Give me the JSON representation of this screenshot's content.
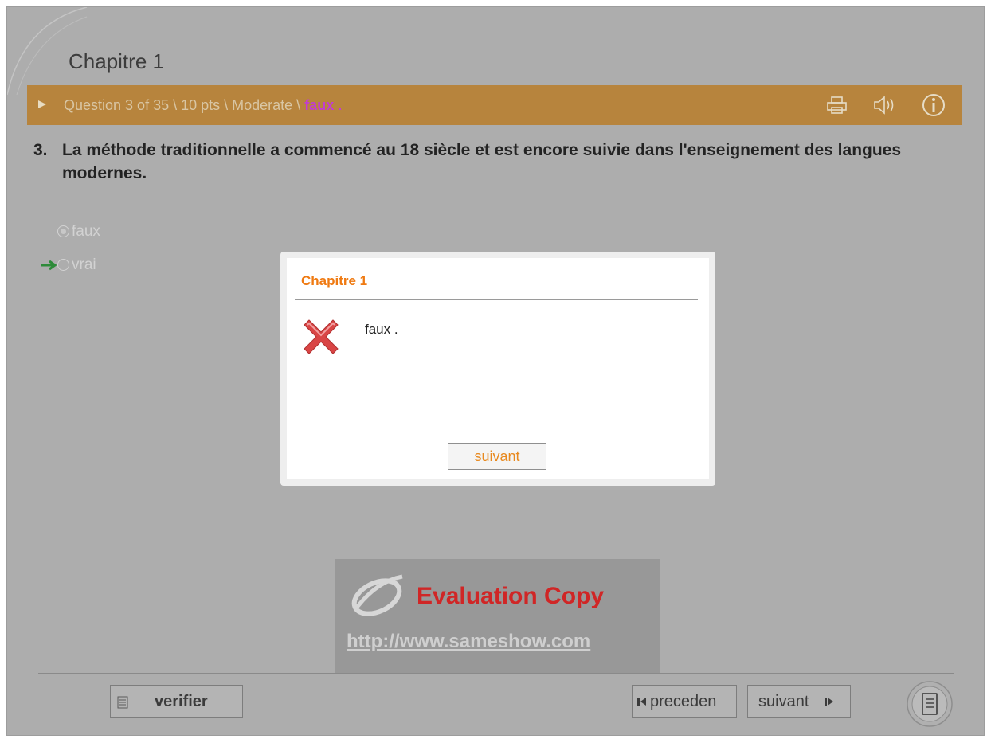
{
  "header": {
    "title": "Chapitre 1"
  },
  "question_bar": {
    "text": "Question 3 of 35 \\ 10 pts \\ Moderate \\ ",
    "status": "faux .",
    "icons": [
      "printer-icon",
      "speaker-icon",
      "info-icon"
    ]
  },
  "question": {
    "number": "3.",
    "text": "La méthode traditionnelle a commencé au 18 siècle et est encore suivie dans l'enseignement des langues modernes."
  },
  "options": [
    {
      "label": "faux",
      "selected": true
    },
    {
      "label": "vrai",
      "selected": false,
      "correct": true
    }
  ],
  "dialog": {
    "title": "Chapitre 1",
    "message": "faux .",
    "button": "suivant"
  },
  "watermark": {
    "title": "Evaluation Copy",
    "url": "http://www.sameshow.com"
  },
  "footer": {
    "verify_label": "verifier",
    "prev_label": "preceden",
    "next_label": "suivant"
  },
  "colors": {
    "background": "#adadad",
    "question_bar": "#b7843d",
    "status_text": "#c23bd4",
    "dialog_title": "#ef7a12",
    "watermark_title": "#d02626",
    "correct_arrow": "#2e8b3a"
  }
}
